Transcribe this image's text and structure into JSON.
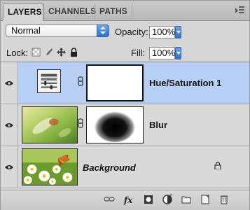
{
  "tabs": [
    {
      "label": "LAYERS",
      "active": true
    },
    {
      "label": "CHANNELS",
      "active": false
    },
    {
      "label": "PATHS",
      "active": false
    }
  ],
  "blend_mode": {
    "value": "Normal"
  },
  "opacity": {
    "label": "Opacity:",
    "value": "100%"
  },
  "lock": {
    "label": "Lock:",
    "icons": [
      "lock-transparent-icon",
      "lock-image-icon",
      "lock-position-icon",
      "lock-all-icon"
    ]
  },
  "fill": {
    "label": "Fill:",
    "value": "100%"
  },
  "layers": [
    {
      "name": "Hue/Saturation 1",
      "type": "adjustment",
      "selected": true,
      "visible": true,
      "italic": false
    },
    {
      "name": "Blur",
      "type": "image-with-mask",
      "selected": false,
      "visible": true,
      "italic": false
    },
    {
      "name": "Background",
      "type": "background",
      "selected": false,
      "visible": true,
      "italic": true,
      "locked": true
    }
  ],
  "bottom_icons": [
    "link-layers-icon",
    "layer-style-fx-icon",
    "add-mask-icon",
    "adjustment-layer-icon",
    "new-group-icon",
    "new-layer-icon",
    "trash-icon"
  ],
  "colors": {
    "selection": "#b7cff5",
    "accent": "#2c6fd6",
    "panel": "#d6d6d6"
  }
}
